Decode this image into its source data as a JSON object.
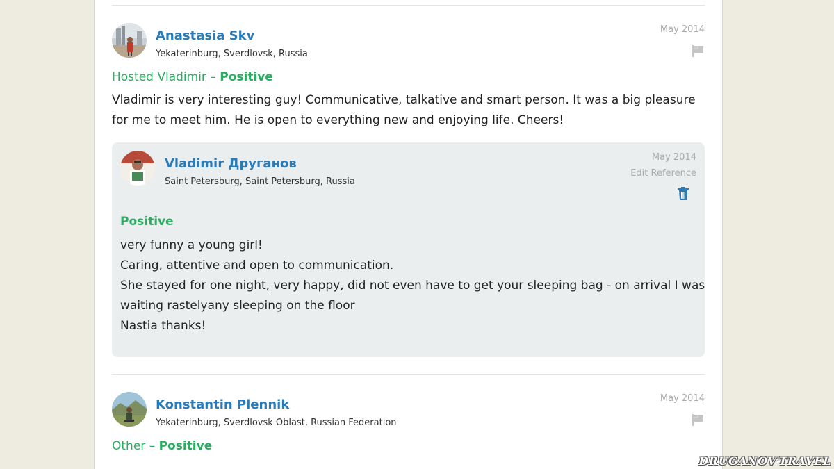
{
  "references": [
    {
      "author_name": "Anastasia Skv",
      "author_location": "Yekaterinburg, Sverdlovsk, Russia",
      "date": "May 2014",
      "heading_prefix": "Hosted Vladimir – ",
      "rating": "Positive",
      "body": "Vladimir is very interesting guy! Communicative, talkative and smart person. It was a big pleasure for me to meet him. He is open to everything new and enjoying life. Cheers!",
      "response": {
        "author_name": "Vladimir Друганов",
        "author_location": "Saint Petersburg, Saint Petersburg, Russia",
        "date": "May 2014",
        "edit_label": "Edit Reference",
        "rating": "Positive",
        "lines": [
          "very funny a young girl!",
          "Caring, attentive and open to communication.",
          "She stayed for one night, very happy, did not even have to get your sleeping bag - on arrival I was",
          "waiting rastelyany sleeping on the floor",
          "Nastia thanks!"
        ]
      }
    },
    {
      "author_name": "Konstantin Plennik",
      "author_location": "Yekaterinburg, Sverdlovsk Oblast, Russian Federation",
      "date": "May 2014",
      "heading_prefix": "Other – ",
      "rating": "Positive"
    }
  ],
  "watermark": "DRUGANOV-TRAVEL",
  "colors": {
    "link": "#2b7bb8",
    "positive": "#27ae60",
    "muted": "#aaaaaa",
    "response_bg": "#ebeeef"
  },
  "icons": {
    "flag": "flag-icon",
    "trash": "trash-icon"
  }
}
